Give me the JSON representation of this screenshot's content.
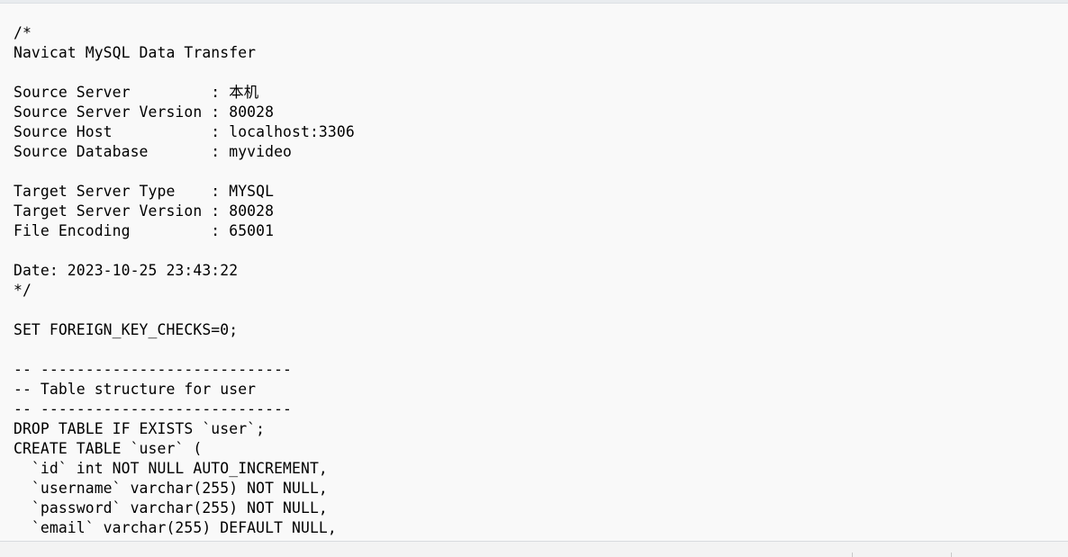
{
  "editor": {
    "lines": [
      "/*",
      "Navicat MySQL Data Transfer",
      "",
      "Source Server         : 本机",
      "Source Server Version : 80028",
      "Source Host           : localhost:3306",
      "Source Database       : myvideo",
      "",
      "Target Server Type    : MYSQL",
      "Target Server Version : 80028",
      "File Encoding         : 65001",
      "",
      "Date: 2023-10-25 23:43:22",
      "*/",
      "",
      "SET FOREIGN_KEY_CHECKS=0;",
      "",
      "-- ----------------------------",
      "-- Table structure for user",
      "-- ----------------------------",
      "DROP TABLE IF EXISTS `user`;",
      "CREATE TABLE `user` (",
      "  `id` int NOT NULL AUTO_INCREMENT,",
      "  `username` varchar(255) NOT NULL,",
      "  `password` varchar(255) NOT NULL,",
      "  `email` varchar(255) DEFAULT NULL,"
    ]
  },
  "statusbar": {
    "position": "",
    "encoding": ""
  }
}
